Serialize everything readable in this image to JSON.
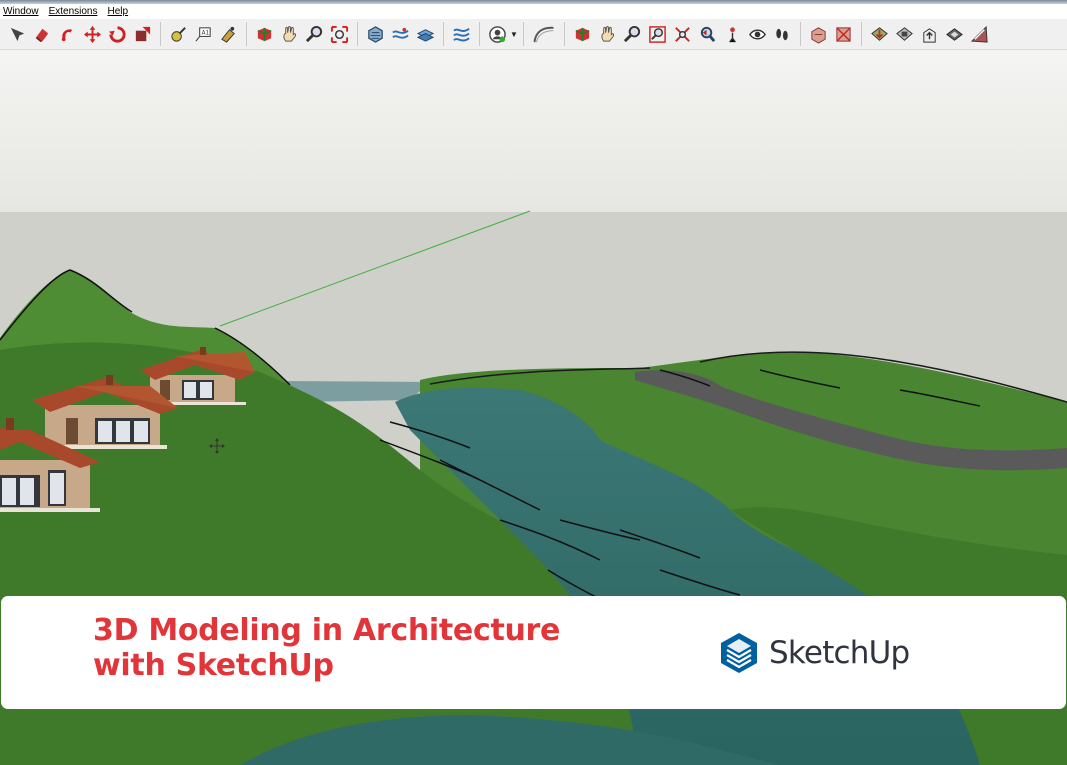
{
  "menu": {
    "items": [
      "Window",
      "Extensions",
      "Help"
    ]
  },
  "toolbar": {
    "groups": [
      [
        "select-arrow-icon",
        "eraser-icon",
        "paint-bucket-icon",
        "move-icon",
        "rotate-icon",
        "scale-icon"
      ],
      [
        "tape-measure-icon",
        "text-label-icon",
        "paint-icon"
      ],
      [
        "orbit-icon",
        "pan-icon",
        "zoom-icon",
        "zoom-extents-icon"
      ],
      [
        "sandbox-from-contours-icon",
        "sandbox-smoove-icon",
        "sandbox-stamp-icon"
      ],
      [
        "sandbox-drape-icon"
      ],
      [
        "user-account-icon"
      ],
      [
        "arc-icon"
      ],
      [
        "orbit-2-icon",
        "pan-2-icon",
        "zoom-2-icon",
        "zoom-window-icon",
        "zoom-extents-2-icon",
        "previous-view-icon",
        "position-camera-icon",
        "look-around-icon",
        "walk-icon"
      ],
      [
        "section-plane-icon",
        "section-fill-icon"
      ],
      [
        "warehouse-icon",
        "extension-warehouse-icon",
        "share-model-icon",
        "layout-icon",
        "send-to-layout-icon"
      ]
    ]
  },
  "banner": {
    "title_line1": "3D Modeling in Architecture",
    "title_line2": "with SketchUp",
    "logo_text": "SketchUp",
    "title_color": "#e2353a",
    "logo_color": "#005f9e"
  },
  "viewport": {
    "sky_color": "#f4f4f2",
    "horizon_color": "#d0d0ca",
    "terrain_color": "#3f7a2a",
    "water_color": "#2f6a66",
    "road_color": "#5a5a5a",
    "roof_color": "#a8492b"
  }
}
